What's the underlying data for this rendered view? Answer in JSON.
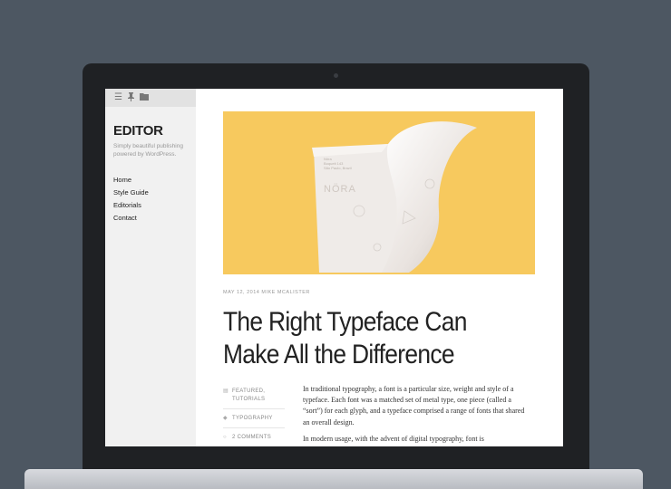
{
  "sidebar": {
    "toolbar_icons": [
      "menu-icon",
      "pin-icon",
      "folder-icon"
    ],
    "site_title": "EDITOR",
    "site_description": "Simply beautiful publishing powered by WordPress.",
    "nav": [
      "Home",
      "Style Guide",
      "Editorials",
      "Contact"
    ]
  },
  "featured_image": {
    "paper_lines": [
      "Nöra",
      "Boqueit 143",
      "São Paulo, Brazil"
    ],
    "paper_logo": "NÖRA"
  },
  "post": {
    "meta": "MAY 12, 2014 MIKE MCALISTER",
    "title": "The Right Typeface Can Make All the Difference",
    "categories": "FEATURED, TUTORIALS",
    "tags": "TYPOGRAPHY",
    "comments": "2 COMMENTS",
    "paragraphs": [
      "In traditional typography, a font is a particular size, weight and style of a typeface. Each font was a matched set of metal type, one piece (called a “sort”) for each glyph, and a typeface comprised a range of fonts that shared an overall design.",
      "In modern usage, with the advent of digital typography, font is"
    ]
  },
  "colors": {
    "background": "#4d5762",
    "featured_bg": "#f7c95e",
    "sidebar_bg": "#f1f1f1"
  }
}
